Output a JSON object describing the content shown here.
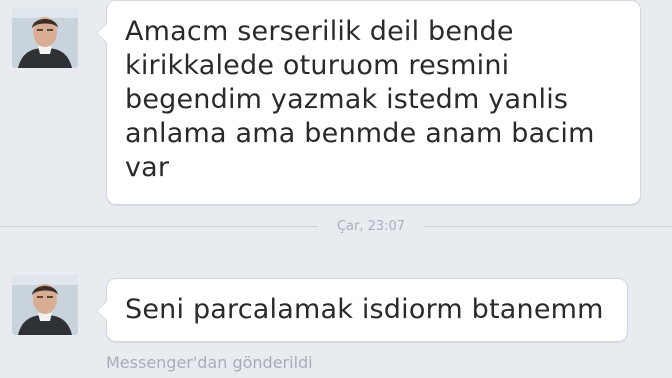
{
  "messages": [
    {
      "text": "Amacm serserilik deil bende\nkirikkalede oturuom resmini\nbegendim yazmak istedm yanlis\nanlama ama benmde anam bacim\nvar"
    },
    {
      "text": "Seni parcalamak isdiorm btanemm"
    }
  ],
  "timestamp_divider": "Çar, 23:07",
  "footer": {
    "sent_via": "Messenger'dan gönderildi"
  },
  "colors": {
    "background": "#e8ebf0",
    "bubble": "#ffffff",
    "bubble_border": "#d3d8de",
    "text": "#2a2a2a",
    "meta_text": "#a8aeb6"
  },
  "icons": {
    "avatar": "profile-photo-avatar"
  }
}
